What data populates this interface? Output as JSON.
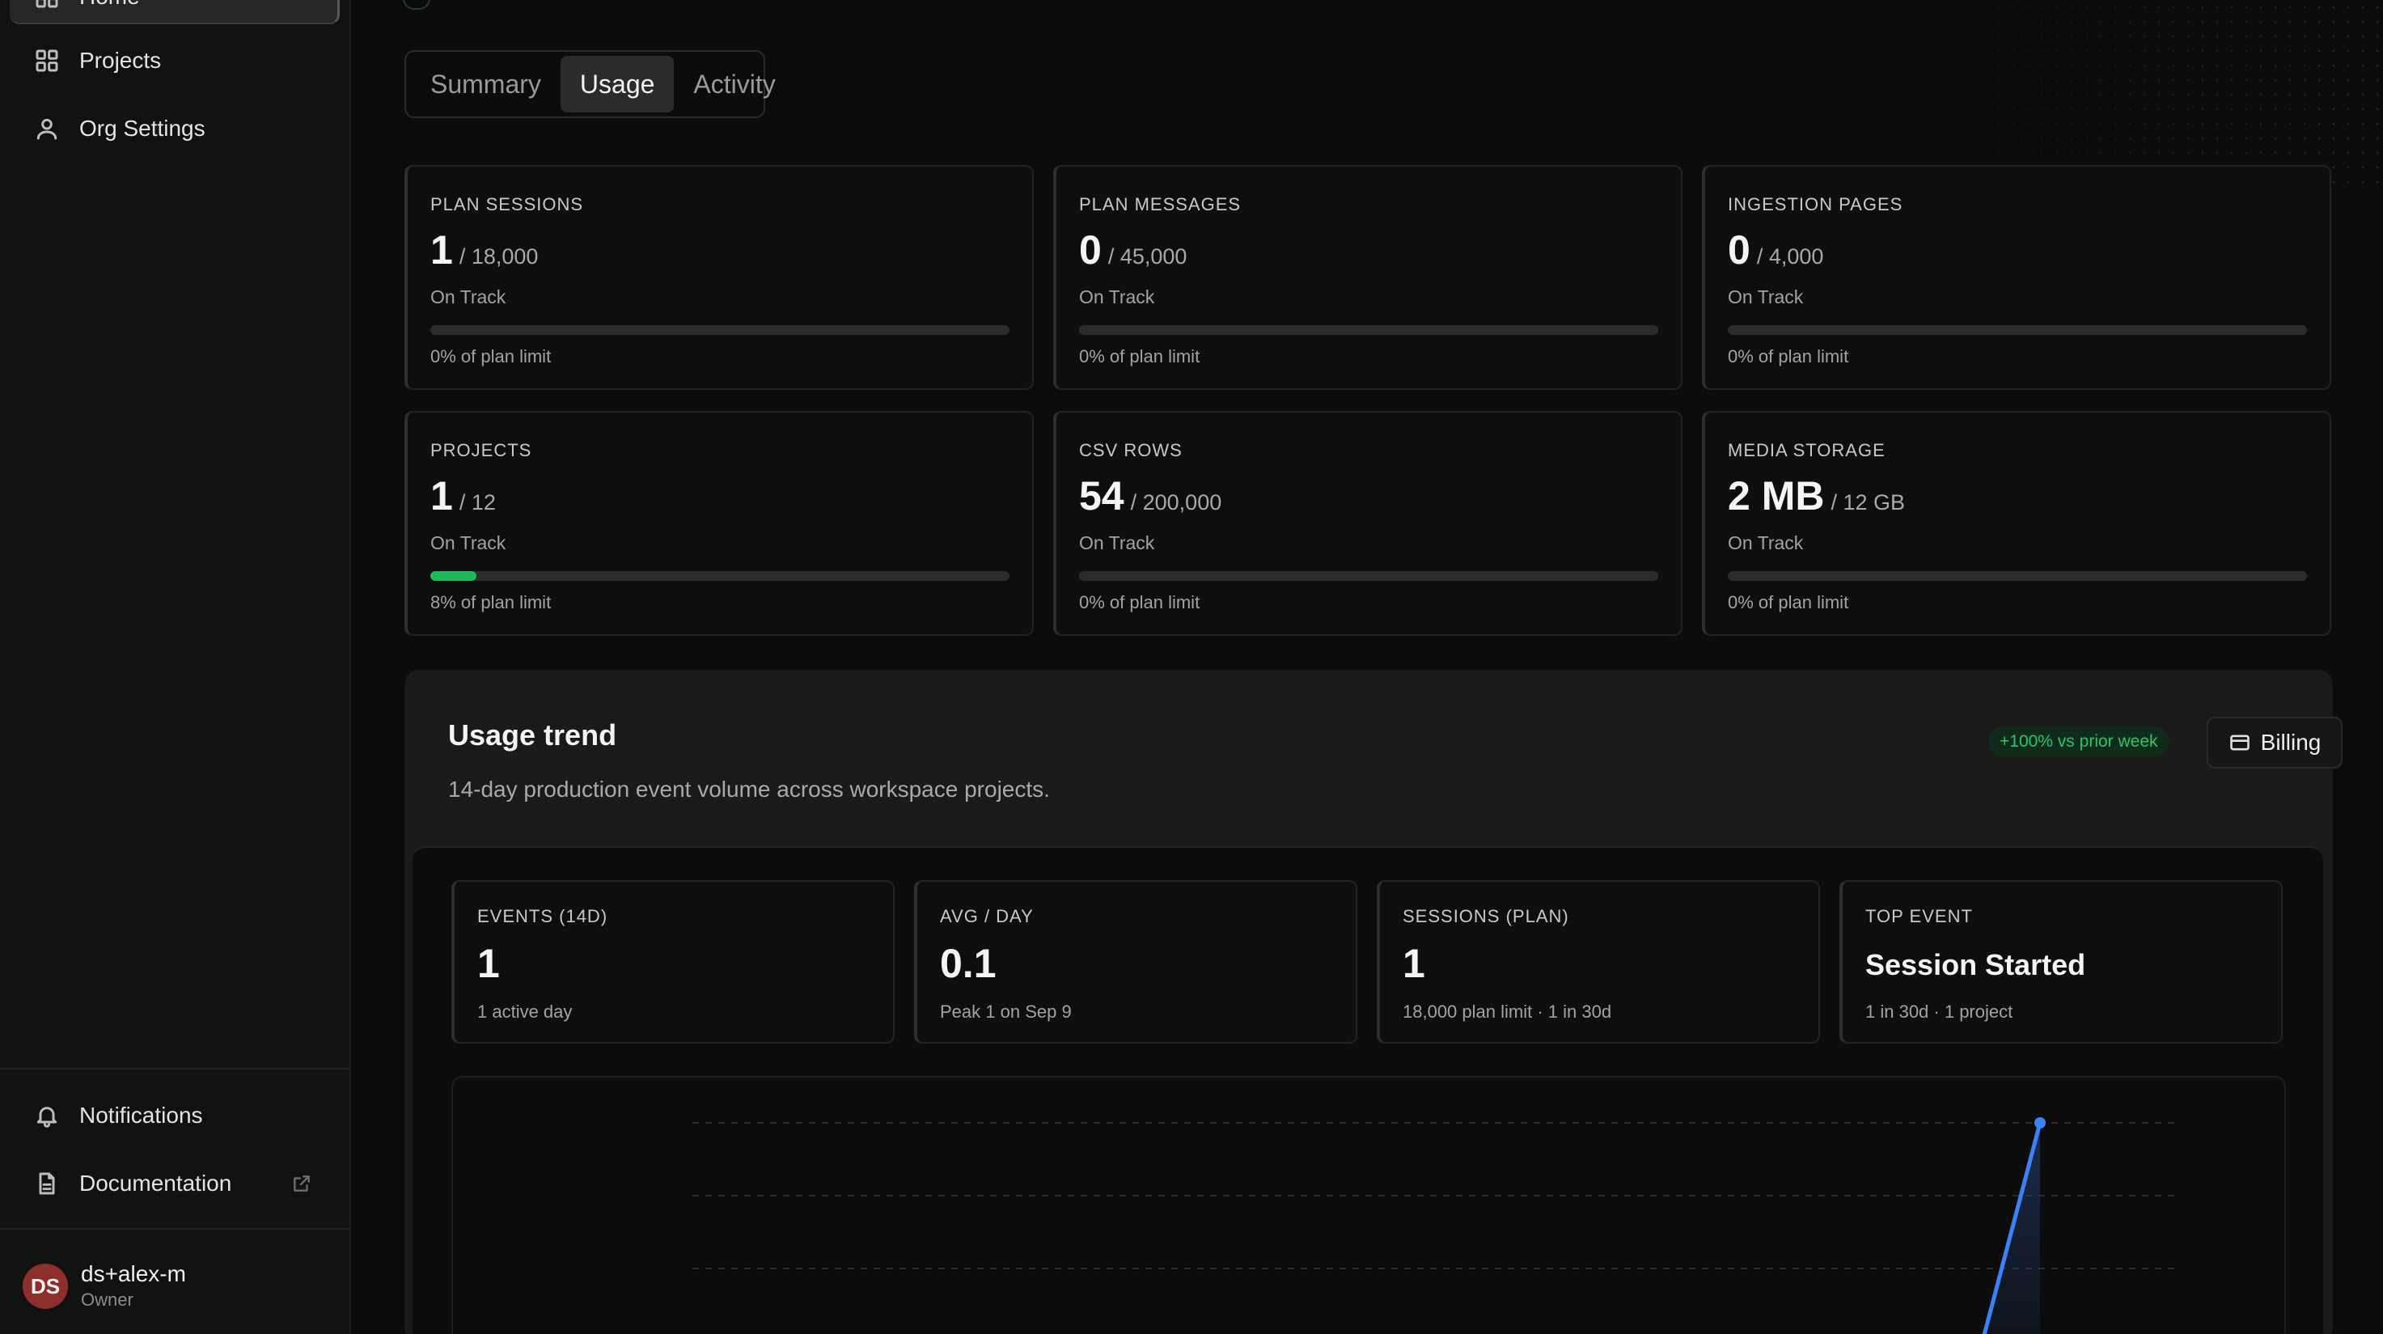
{
  "sidebar": {
    "items": [
      {
        "label": "Home",
        "icon": "home-icon"
      },
      {
        "label": "Projects",
        "icon": "grid-icon"
      },
      {
        "label": "Org Settings",
        "icon": "user-icon"
      }
    ],
    "bottom": [
      {
        "label": "Notifications",
        "icon": "bell-icon"
      },
      {
        "label": "Documentation",
        "icon": "document-icon"
      }
    ],
    "user": {
      "initials": "DS",
      "name": "ds+alex-m",
      "role": "Owner"
    }
  },
  "tabs": [
    "Summary",
    "Usage",
    "Activity"
  ],
  "active_tab": "Usage",
  "usage_cards": [
    {
      "label": "PLAN SESSIONS",
      "value": "1",
      "limit": "/ 18,000",
      "status": "On Track",
      "fill": 0,
      "percent_text": "0% of plan limit"
    },
    {
      "label": "PLAN MESSAGES",
      "value": "0",
      "limit": "/ 45,000",
      "status": "On Track",
      "fill": 0,
      "percent_text": "0% of plan limit"
    },
    {
      "label": "INGESTION PAGES",
      "value": "0",
      "limit": "/ 4,000",
      "status": "On Track",
      "fill": 0,
      "percent_text": "0% of plan limit"
    },
    {
      "label": "PROJECTS",
      "value": "1",
      "limit": "/ 12",
      "status": "On Track",
      "fill": 0.08,
      "percent_text": "8% of plan limit"
    },
    {
      "label": "CSV ROWS",
      "value": "54",
      "limit": "/ 200,000",
      "status": "On Track",
      "fill": 0,
      "percent_text": "0% of plan limit"
    },
    {
      "label": "MEDIA STORAGE",
      "value": "2 MB",
      "limit": "/ 12 GB",
      "status": "On Track",
      "fill": 0,
      "percent_text": "0% of plan limit"
    }
  ],
  "trend": {
    "title": "Usage trend",
    "subtitle": "14-day production event volume across workspace projects.",
    "badge": "+100% vs prior week",
    "billing_label": "Billing",
    "stats": [
      {
        "label": "EVENTS (14D)",
        "value": "1",
        "note": "1 active day"
      },
      {
        "label": "AVG / DAY",
        "value": "0.1",
        "note": "Peak 1 on Sep 9"
      },
      {
        "label": "SESSIONS (PLAN)",
        "value": "1",
        "note": "18,000 plan limit · 1 in 30d"
      },
      {
        "label": "TOP EVENT",
        "value": "Session Started",
        "note": "1 in 30d · 1 project"
      }
    ]
  },
  "colors": {
    "accent_green": "#1fb858",
    "line_blue": "#3b82f6",
    "avatar_red": "#8e2e2b"
  }
}
